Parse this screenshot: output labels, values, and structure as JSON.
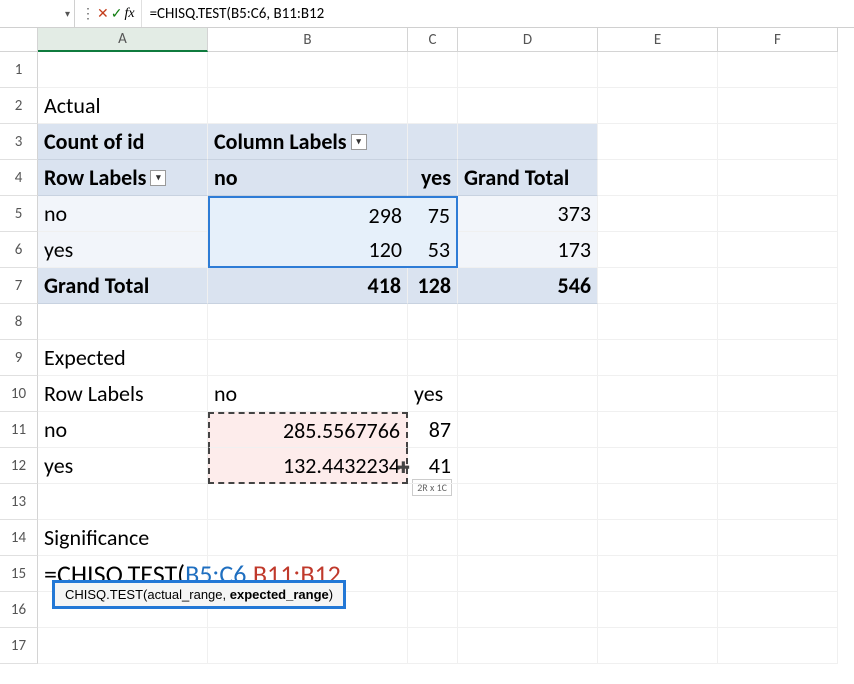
{
  "formula_bar": {
    "text": "=CHISQ.TEST(B5:C6, B11:B12"
  },
  "columns": [
    "A",
    "B",
    "C",
    "D",
    "E",
    "F"
  ],
  "rows": [
    "1",
    "2",
    "3",
    "4",
    "5",
    "6",
    "7",
    "8",
    "9",
    "10",
    "11",
    "12",
    "13",
    "14",
    "15",
    "16",
    "17"
  ],
  "cells": {
    "A2": "Actual",
    "A3": "Count of id",
    "B3": "Column Labels",
    "A4": "Row Labels",
    "B4": "no",
    "C4": "yes",
    "D4": "Grand Total",
    "A5": "no",
    "B5": "298",
    "C5": "75",
    "D5": "373",
    "A6": "yes",
    "B6": "120",
    "C6": "53",
    "D6": "173",
    "A7": "Grand Total",
    "B7": "418",
    "C7": "128",
    "D7": "546",
    "A9": "Expected",
    "A10": "Row Labels",
    "B10": "no",
    "C10": "yes",
    "A11": "no",
    "B11": "285.5567766",
    "C11": "87",
    "A12": "yes",
    "B12": "132.4432234",
    "C12": "41",
    "A14": "Significance",
    "formula_parts": {
      "p1": "=CHISQ.TEST(",
      "p2": "B5:C6",
      "p3": ", ",
      "p4": "B11:B12"
    }
  },
  "tooltip": {
    "fn": "CHISQ.TEST(",
    "arg1": "actual_range, ",
    "arg2": "expected_range",
    "close": ")"
  },
  "size_badge": "2R x 1C",
  "chart_data": {
    "type": "table",
    "actual": {
      "rows": [
        "no",
        "yes"
      ],
      "cols": [
        "no",
        "yes"
      ],
      "values": [
        [
          298,
          75
        ],
        [
          120,
          53
        ]
      ],
      "row_totals": [
        373,
        173
      ],
      "col_totals": [
        418,
        128
      ],
      "grand_total": 546
    },
    "expected": {
      "rows": [
        "no",
        "yes"
      ],
      "cols": [
        "no",
        "yes"
      ],
      "values": [
        [
          285.5567766,
          87
        ],
        [
          132.4432234,
          41
        ]
      ]
    }
  }
}
